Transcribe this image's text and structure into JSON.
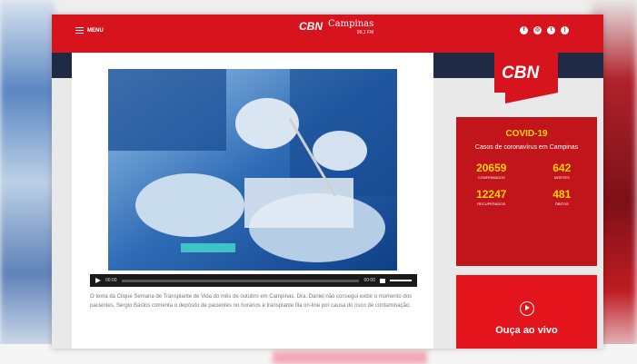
{
  "header": {
    "menu_label": "MENU",
    "brand_name": "CBN",
    "brand_city": "Campinas",
    "brand_frequency": "99,1 FM",
    "social": [
      "facebook-icon",
      "instagram-icon",
      "twitter-icon",
      "rss-icon"
    ]
  },
  "side_logo": {
    "text": "CBN"
  },
  "player": {
    "current_time": "00:00",
    "duration": "00:00"
  },
  "article": {
    "caption": "O tema da Clique Semana de Transplante de Vida do mês de outubro em Campinas. Dra. Daniel não consegui exibir o momento dos pacientes, Sergio Bastos comenta o depósito de pacientes no horários e transplante fila on-line por causa do risco de contaminação."
  },
  "covid": {
    "title": "COVID-19",
    "subtitle": "Casos de coronavírus em Campinas",
    "stats": [
      {
        "value": "20659",
        "label": "CONFIRMADOS"
      },
      {
        "value": "642",
        "label": "MORTES"
      },
      {
        "value": "12247",
        "label": "RECUPERADOS"
      },
      {
        "value": "481",
        "label": "ÓBITOS"
      }
    ]
  },
  "live": {
    "label": "Ouça ao vivo"
  },
  "colors": {
    "brand_red": "#d7141d",
    "covid_red": "#c2141b",
    "accent_yellow": "#ffd400",
    "navy": "#1f2a44"
  }
}
